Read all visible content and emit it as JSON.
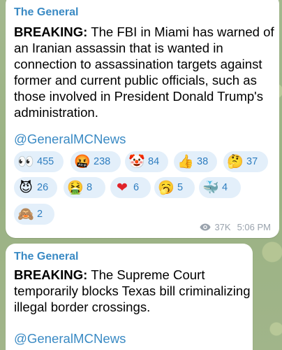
{
  "messages": [
    {
      "channel": "The General",
      "headline_bold": "BREAKING:",
      "body": " The FBI in Miami has warned of an Iranian assassin that is wanted in connection to assassination targets against former and current public officials, such as those involved in President Donald Trump's administration.",
      "handle": "@GeneralMCNews",
      "reactions": [
        {
          "icon": "eyes-icon",
          "glyph": "👀",
          "count": "455"
        },
        {
          "icon": "cursing-face-icon",
          "glyph": "🤬",
          "count": "238"
        },
        {
          "icon": "clown-face-icon",
          "glyph": "🤡",
          "count": "84"
        },
        {
          "icon": "thumbs-up-icon",
          "glyph": "👍",
          "count": "38"
        },
        {
          "icon": "thinking-face-icon",
          "glyph": "🤔",
          "count": "37"
        },
        {
          "icon": "smiling-devil-icon",
          "glyph": "😈",
          "count": "26"
        },
        {
          "icon": "vomiting-face-icon",
          "glyph": "🤮",
          "count": "8"
        },
        {
          "icon": "red-heart-icon",
          "glyph": "❤",
          "count": "6"
        },
        {
          "icon": "yawning-face-icon",
          "glyph": "🥱",
          "count": "5"
        },
        {
          "icon": "whale-icon",
          "glyph": "🐳",
          "count": "4"
        },
        {
          "icon": "see-no-evil-monkey-icon",
          "glyph": "🙈",
          "count": "2"
        }
      ],
      "views": "37K",
      "time": "5:06 PM"
    },
    {
      "channel": "The General",
      "headline_bold": "BREAKING:",
      "body": " The Supreme Court temporarily blocks Texas bill criminalizing illegal border crossings.",
      "handle": "@GeneralMCNews"
    }
  ],
  "colors": {
    "accent": "#3a8ac4",
    "reaction_bg": "#e3effa",
    "meta": "#9aa3ad",
    "wallpaper": "#9fb489"
  }
}
